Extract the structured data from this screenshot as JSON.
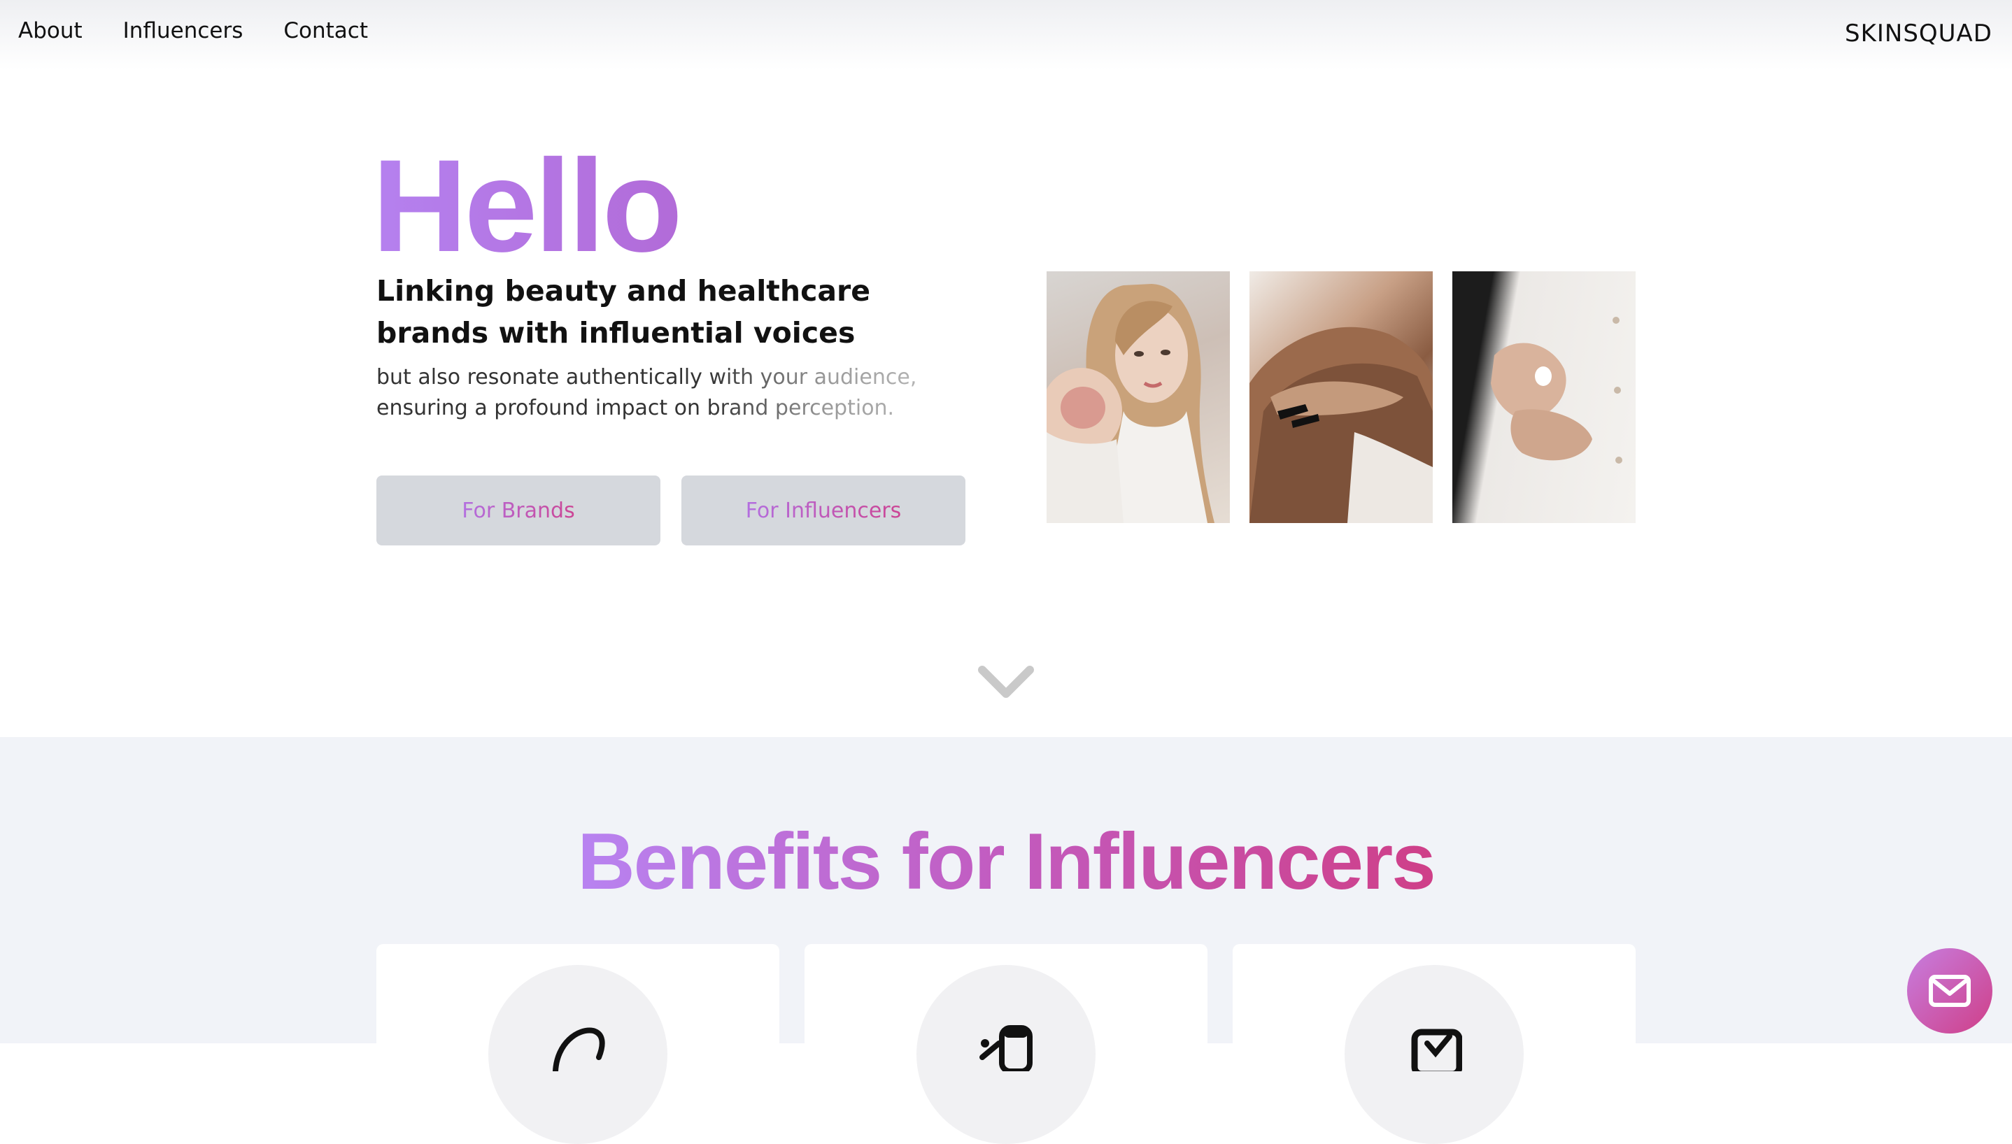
{
  "nav": {
    "items": [
      {
        "label": "About"
      },
      {
        "label": "Influencers"
      },
      {
        "label": "Contact"
      }
    ],
    "brand": "SKINSQUAD"
  },
  "hero": {
    "title": "Hello",
    "subtitle": "Linking beauty and healthcare brands with influential voices",
    "description": "but also resonate authentically with your audience, ensuring a profound impact on brand perception.",
    "buttons": {
      "brands": "For Brands",
      "influencers": "For Influencers"
    }
  },
  "benefits": {
    "title": "Benefits for Influencers",
    "cards": [
      {
        "icon": "lotion-bottle-icon"
      },
      {
        "icon": "product-tube-icon"
      },
      {
        "icon": "checkbox-icon"
      }
    ]
  },
  "colors": {
    "accent_purple": "#b581ef",
    "accent_pink": "#cf3f88",
    "button_bg": "#d5d8dd",
    "section_bg": "#f1f3f8"
  }
}
